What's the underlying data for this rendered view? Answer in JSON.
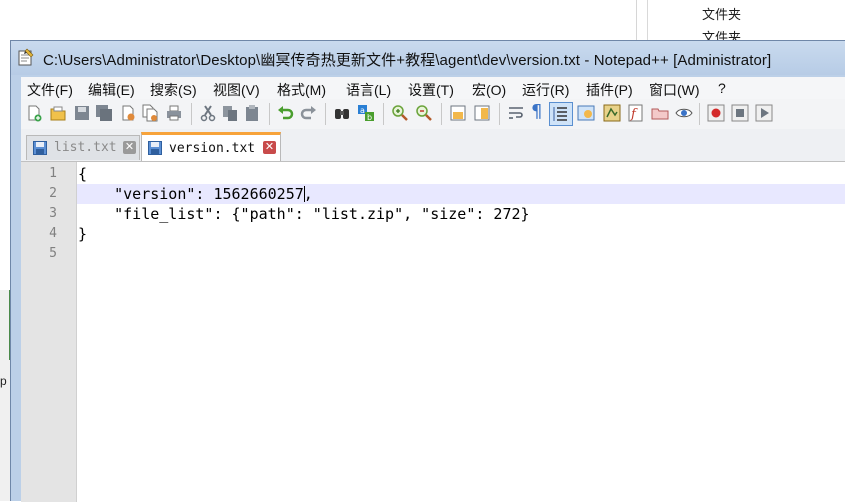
{
  "background": {
    "folders": [
      "文件夹",
      "文件夹"
    ],
    "left_item": "p"
  },
  "window": {
    "title": "C:\\Users\\Administrator\\Desktop\\幽冥传奇热更新文件+教程\\agent\\dev\\version.txt - Notepad++ [Administrator]",
    "icon": "notepad-icon"
  },
  "menu": [
    {
      "label": "文件(F)"
    },
    {
      "label": "编辑(E)"
    },
    {
      "label": "搜索(S)"
    },
    {
      "label": "视图(V)"
    },
    {
      "label": "格式(M)"
    },
    {
      "label": "语言(L)"
    },
    {
      "label": "设置(T)"
    },
    {
      "label": "宏(O)"
    },
    {
      "label": "运行(R)"
    },
    {
      "label": "插件(P)"
    },
    {
      "label": "窗口(W)"
    },
    {
      "label": "?"
    }
  ],
  "toolbar": [
    "new-file-icon",
    "open-file-icon",
    "save-icon",
    "save-all-icon",
    "close-icon",
    "close-all-icon",
    "print-icon",
    "cut-icon",
    "copy-icon",
    "paste-icon",
    "undo-icon",
    "redo-icon",
    "find-icon",
    "replace-icon",
    "zoom-in-icon",
    "zoom-out-icon",
    "sync-vertical-icon",
    "sync-horizontal-icon",
    "word-wrap-icon",
    "show-all-chars-icon",
    "indent-guide-icon",
    "user-language-icon",
    "document-map-icon",
    "function-list-icon",
    "folder-as-workspace-icon",
    "monitoring-icon",
    "record-macro-icon",
    "stop-record-icon"
  ],
  "tabs": [
    {
      "label": "list.txt",
      "active": false
    },
    {
      "label": "version.txt",
      "active": true
    }
  ],
  "editor": {
    "line_numbers": [
      "1",
      "2",
      "3",
      "4",
      "5"
    ],
    "lines": [
      "{",
      "    \"version\": 1562660257",
      "    \"file_list\": {\"path\": \"list.zip\", \"size\": 272}",
      "}",
      ""
    ],
    "line2_after_caret": ",",
    "current_line": 2
  },
  "colors": {
    "title_bg": "#c9daee",
    "active_tab_accent": "#f7a33a",
    "close_active": "#c84b4b",
    "close_inactive": "#9a9a9a",
    "current_line": "#e8e8ff",
    "gutter": "#e4e4e4"
  }
}
